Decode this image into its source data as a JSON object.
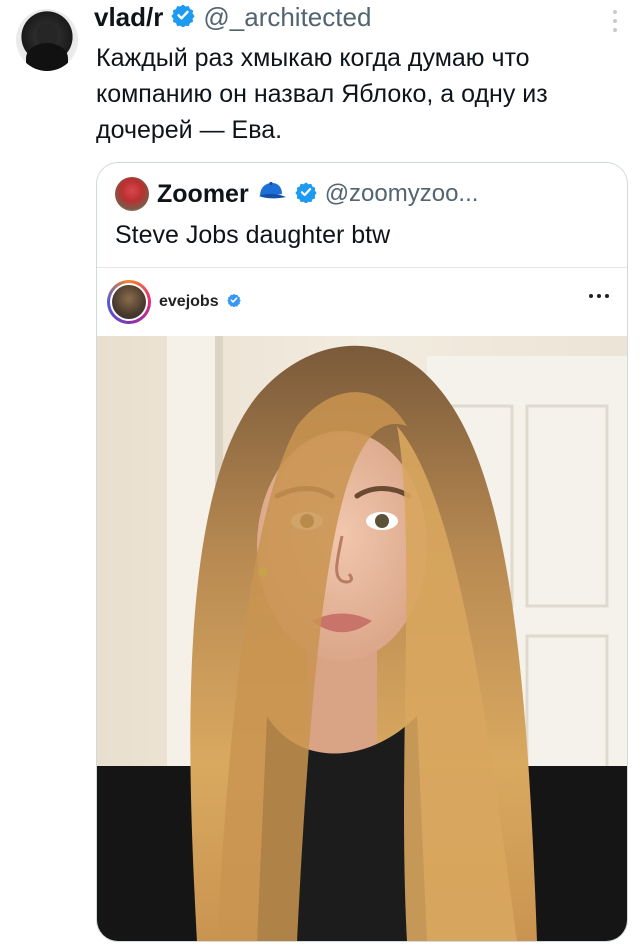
{
  "tweet": {
    "author_name": "vlad/r",
    "author_handle": "@_architected",
    "text": "Каждый раз хмыкаю когда думаю что компанию он назвал Яблоко, а одну из дочерей — Ева.",
    "text_lines": [
      "Каждый раз хмыкаю когда думаю что",
      "компанию он назвал Яблоко, а одну из",
      "дочерей — Ева."
    ],
    "verified_color": "#1d9bf0"
  },
  "quoted": {
    "author_name": "Zoomer",
    "author_handle": "@zoomyzoo...",
    "text": "Steve Jobs daughter btw",
    "cap_icon": "blue-cap-icon"
  },
  "instagram_post": {
    "username": "evejobs",
    "verified_color": "#3897f0"
  }
}
